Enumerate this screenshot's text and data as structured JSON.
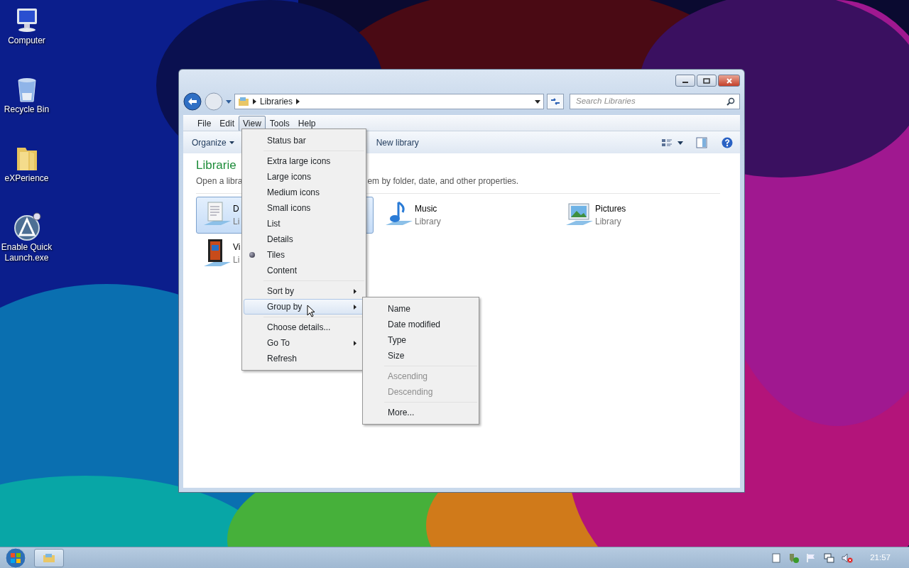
{
  "desktop_icons": [
    {
      "label": "Computer",
      "kind": "computer"
    },
    {
      "label": "Recycle Bin",
      "kind": "recycle"
    },
    {
      "label": "eXPerience",
      "kind": "folder"
    },
    {
      "label": "Enable Quick Launch.exe",
      "kind": "app"
    }
  ],
  "window": {
    "address": "Libraries",
    "search": {
      "placeholder": "Search Libraries"
    },
    "menubar": [
      {
        "label": "File",
        "selected": false
      },
      {
        "label": "Edit",
        "selected": false
      },
      {
        "label": "View",
        "selected": true
      },
      {
        "label": "Tools",
        "selected": false
      },
      {
        "label": "Help",
        "selected": false
      }
    ],
    "toolbar": {
      "organize": "Organize",
      "new_library": "New library"
    },
    "heading": "Librarie",
    "description": [
      "Open a libra",
      "em by folder, date, and other properties."
    ],
    "libraries": [
      {
        "name": "D",
        "type": "Li",
        "kind": "documents",
        "selected": true
      },
      {
        "name": "Music",
        "type": "Library",
        "kind": "music",
        "selected": false
      },
      {
        "name": "Pictures",
        "type": "Library",
        "kind": "pictures",
        "selected": false
      },
      {
        "name": "Vi",
        "type": "Li",
        "kind": "videos",
        "selected": false
      }
    ],
    "view_menu": [
      [
        {
          "label": "Status bar",
          "checked": false,
          "submenu": false,
          "selected": false
        }
      ],
      [
        {
          "label": "Extra large icons",
          "checked": false,
          "submenu": false,
          "selected": false
        },
        {
          "label": "Large icons",
          "checked": false,
          "submenu": false,
          "selected": false
        },
        {
          "label": "Medium icons",
          "checked": false,
          "submenu": false,
          "selected": false
        },
        {
          "label": "Small icons",
          "checked": false,
          "submenu": false,
          "selected": false
        },
        {
          "label": "List",
          "checked": false,
          "submenu": false,
          "selected": false
        },
        {
          "label": "Details",
          "checked": false,
          "submenu": false,
          "selected": false
        },
        {
          "label": "Tiles",
          "checked": true,
          "submenu": false,
          "selected": false
        },
        {
          "label": "Content",
          "checked": false,
          "submenu": false,
          "selected": false
        }
      ],
      [
        {
          "label": "Sort by",
          "checked": false,
          "submenu": true,
          "selected": false
        },
        {
          "label": "Group by",
          "checked": false,
          "submenu": true,
          "selected": true
        }
      ],
      [
        {
          "label": "Choose details...",
          "checked": false,
          "submenu": false,
          "selected": false
        },
        {
          "label": "Go To",
          "checked": false,
          "submenu": true,
          "selected": false
        },
        {
          "label": "Refresh",
          "checked": false,
          "submenu": false,
          "selected": false
        }
      ]
    ],
    "group_by_menu": [
      [
        {
          "label": "Name",
          "disabled": false
        },
        {
          "label": "Date modified",
          "disabled": false
        },
        {
          "label": "Type",
          "disabled": false
        },
        {
          "label": "Size",
          "disabled": false
        }
      ],
      [
        {
          "label": "Ascending",
          "disabled": true
        },
        {
          "label": "Descending",
          "disabled": true
        }
      ],
      [
        {
          "label": "More...",
          "disabled": false
        }
      ]
    ]
  },
  "taskbar": {
    "clock": "21:57"
  }
}
